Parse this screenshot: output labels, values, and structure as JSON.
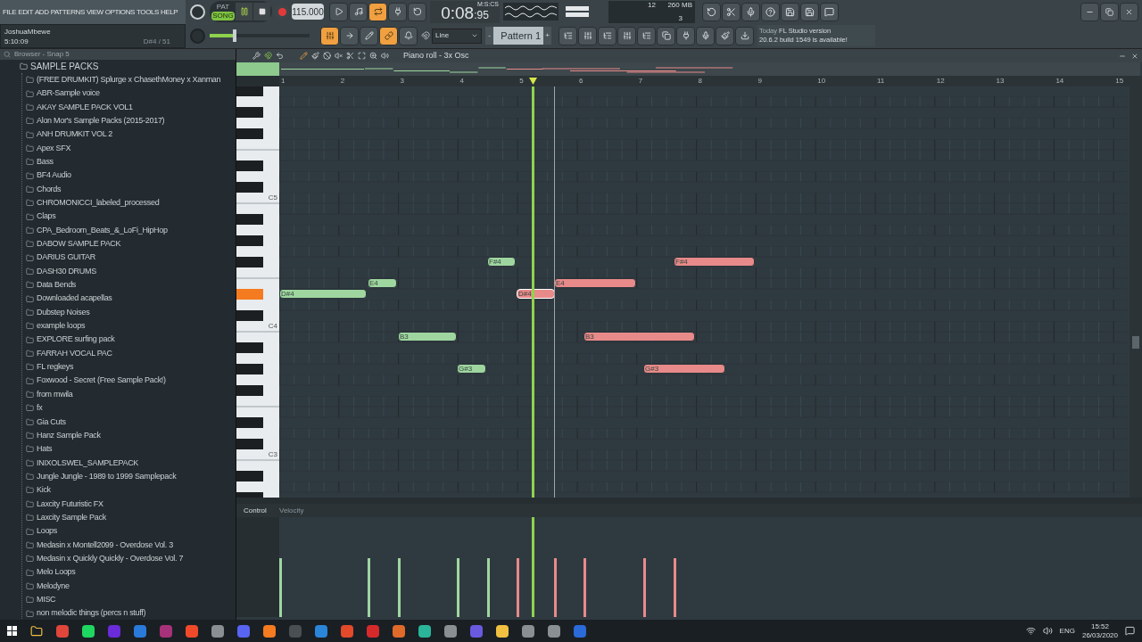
{
  "menu": [
    "FILE",
    "EDIT",
    "ADD",
    "PATTERNS",
    "VIEW",
    "OPTIONS",
    "TOOLS",
    "HELP"
  ],
  "hint": {
    "user": "JoshuaMbewe",
    "time": "5:10:09",
    "note": "D#4 / 51"
  },
  "mode": [
    {
      "label": "PAT",
      "selected": false
    },
    {
      "label": "SONG",
      "selected": true
    }
  ],
  "tempo": "115.000",
  "clock": {
    "main": "0:08",
    "small": ":95",
    "unit": "M:S:CS"
  },
  "master_volume": {
    "level": 0.25
  },
  "cpu": {
    "value": "12",
    "memory": "260 MB",
    "polyphony": "3"
  },
  "snap": "Line",
  "pattern": {
    "minus": "-",
    "name": "Pattern 1",
    "plus": "+"
  },
  "news": {
    "when": "Today",
    "title": "FL Studio version",
    "text": "20.6.2 build 1549 is available!"
  },
  "browser": {
    "title": "Browser - Snap 5",
    "root": "SAMPLE PACKS",
    "children": [
      "(FREE DRUMKIT) Splurge x ChasethMoney x Xanman",
      "ABR-Sample voice",
      "AKAY SAMPLE PACK VOL1",
      "Alon Mor's Sample Packs (2015-2017)",
      "ANH DRUMKIT VOL 2",
      "Apex SFX",
      "Bass",
      "BF4 Audio",
      "Chords",
      "CHROMONICCI_labeled_processed",
      "Claps",
      "CPA_Bedroom_Beats_&_LoFi_HipHop",
      "DABOW SAMPLE PACK",
      "DARIUS GUITAR",
      "DASH30 DRUMS",
      "Data Bends",
      "Downloaded acapellas",
      "Dubstep Noises",
      "example loops",
      "EXPLORE surfing pack",
      "FARRAH VOCAL PAC",
      "FL regkeys",
      "Foxwood - Secret (Free Sample Pack!)",
      "from mwila",
      "fx",
      "Gia Cuts",
      "Hanz Sample Pack",
      "Hats",
      "INIXOLSWEL_SAMPLEPACK",
      "Jungle Jungle - 1989 to 1999 Samplepack",
      "Kick",
      "Laxcity Futuristic FX",
      "Laxcity Sample Pack",
      "Loops",
      "Medasin x Montell2099 - Overdose Vol. 3",
      "Medasin x Quickly Quickly - Overdose Vol. 7",
      "Melo Loops",
      "Melodyne",
      "MISC",
      "non melodic things (percs n stuff)"
    ]
  },
  "piano_roll": {
    "title": "Piano roll - 3x Osc",
    "ruler": [
      "1",
      "2",
      "3",
      "4",
      "5",
      "6",
      "7",
      "8",
      "9",
      "10",
      "11",
      "12",
      "13",
      "14",
      "15"
    ],
    "key_labels": [
      "C5",
      "C4",
      "C3"
    ],
    "notes": [
      {
        "label": "D#4",
        "color": "#9fd6a0",
        "playing": false,
        "level": 0.59
      },
      {
        "label": "E4",
        "color": "#9fd6a0",
        "playing": false,
        "level": 0.59
      },
      {
        "label": "B3",
        "color": "#9fd6a0",
        "playing": false,
        "level": 0.59
      },
      {
        "label": "G#3",
        "color": "#9fd6a0",
        "playing": false,
        "level": 0.59
      },
      {
        "label": "F#4",
        "color": "#9fd6a0",
        "playing": false,
        "level": 0.59
      },
      {
        "label": "D#4",
        "color": "#e88a8a",
        "playing": true,
        "level": 0.59
      },
      {
        "label": "E4",
        "color": "#e88a8a",
        "playing": false,
        "level": 0.59
      },
      {
        "label": "B3",
        "color": "#e88a8a",
        "playing": false,
        "level": 0.59
      },
      {
        "label": "G#3",
        "color": "#e88a8a",
        "playing": false,
        "level": 0.59
      },
      {
        "label": "F#4",
        "color": "#e88a8a",
        "playing": false,
        "level": 0.59
      }
    ],
    "control": "Control",
    "control_target": "Velocity"
  },
  "taskbar": {
    "language": "ENG",
    "time": "15:52",
    "date": "26/03/2020"
  }
}
